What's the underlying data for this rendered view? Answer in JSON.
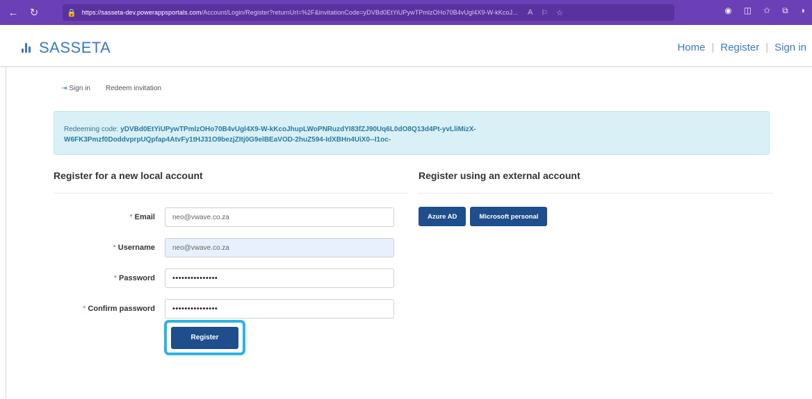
{
  "browser": {
    "url_host": "https://sasseta-dev.powerappsportals.com",
    "url_path": "/Account/Login/Register?returnUrl=%2F&invitationCode=yDVBd0EtYiUPywTPmlzOHo70B4vUgl4X9-W-kKcoJ...",
    "back_icon": "back-arrow-icon",
    "refresh_icon": "refresh-icon",
    "lock_icon": "lock-icon"
  },
  "header": {
    "brand": "SASSETA",
    "nav": [
      "Home",
      "Register",
      "Sign in"
    ]
  },
  "tabs": [
    {
      "label": "Sign in",
      "icon": "sign-in-icon"
    },
    {
      "label": "Redeem invitation"
    }
  ],
  "alert": {
    "prefix": "Redeeming code:",
    "code_line1": "yDVBd0EtYiUPywTPmlzOHo70B4vUgl4X9-W-kKcoJhupLWoPNRuzdYI83fZJ90Uq6L0dO8Q13d4Pt-yvLliMizX-",
    "code_line2": "W6FK3Pmzf0DoddvprpUQpfap4AtvFy1tHJ31O9bezjZItj0G9elBEaVOD-2huZ594-IdXBHn4UiX0--I1oc-"
  },
  "local": {
    "heading": "Register for a new local account",
    "fields": [
      {
        "label": "Email",
        "value": "neo@vwave.co.za"
      },
      {
        "label": "Username",
        "value": "neo@vwave.co.za"
      },
      {
        "label": "Password",
        "value": "•••••••••••••••"
      },
      {
        "label": "Confirm password",
        "value": "•••••••••••••••"
      }
    ],
    "required_mark": "*",
    "register_label": "Register"
  },
  "external": {
    "heading": "Register using an external account",
    "buttons": [
      "Azure AD",
      "Microsoft personal"
    ]
  }
}
